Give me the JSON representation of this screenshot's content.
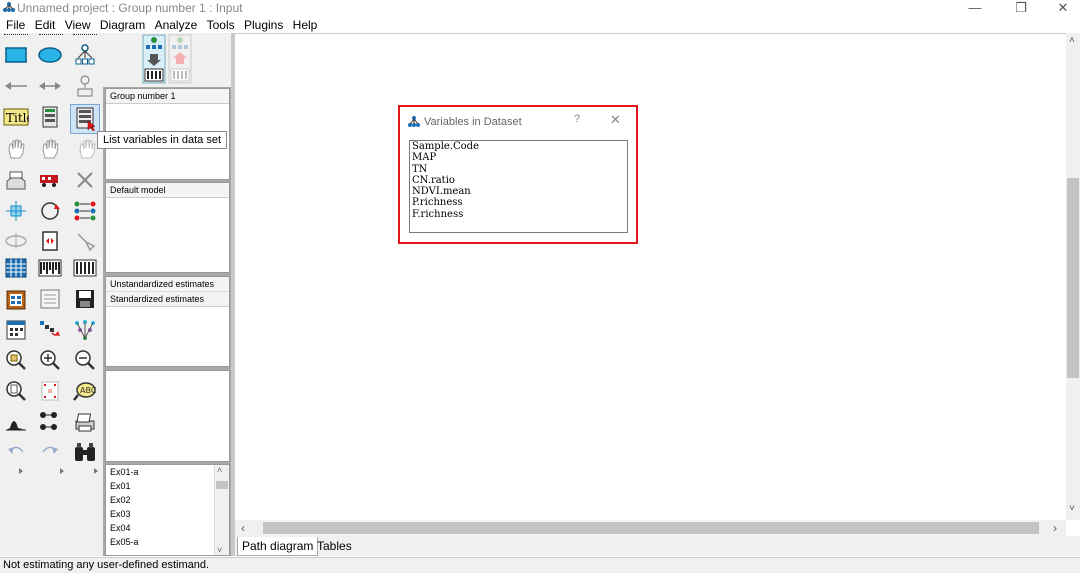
{
  "window": {
    "title": "Unnamed project : Group number 1 : Input",
    "minimize": "—",
    "restore": "❐",
    "close": "✕"
  },
  "menu": [
    "File",
    "Edit",
    "View",
    "Diagram",
    "Analyze",
    "Tools",
    "Plugins",
    "Help"
  ],
  "tooltip": "List variables in data set",
  "panels": {
    "groups": {
      "header": "Group number 1"
    },
    "models": {
      "header": "Default model"
    },
    "estimates": {
      "items": [
        "Unstandardized estimates",
        "Standardized estimates"
      ]
    },
    "files": [
      "Ex01-a",
      "Ex01",
      "Ex02",
      "Ex03",
      "Ex04",
      "Ex05-a"
    ]
  },
  "tabs": [
    "Path diagram",
    "Tables"
  ],
  "status": "Not estimating any user-defined estimand.",
  "dialog": {
    "title": "Variables in Dataset",
    "help": "?",
    "close": "✕",
    "variables": [
      "Sample.Code",
      "MAP",
      "TN",
      "CN.ratio",
      "NDVI.mean",
      "P.richness",
      "F.richness"
    ]
  },
  "scroll_arrows": {
    "left": "‹",
    "right": "›",
    "up": "˄",
    "down": "˅"
  },
  "colors": {
    "accent_red": "#e0161a",
    "tool_blue": "#1a8fc9",
    "tool_yellow": "#f0e060"
  }
}
